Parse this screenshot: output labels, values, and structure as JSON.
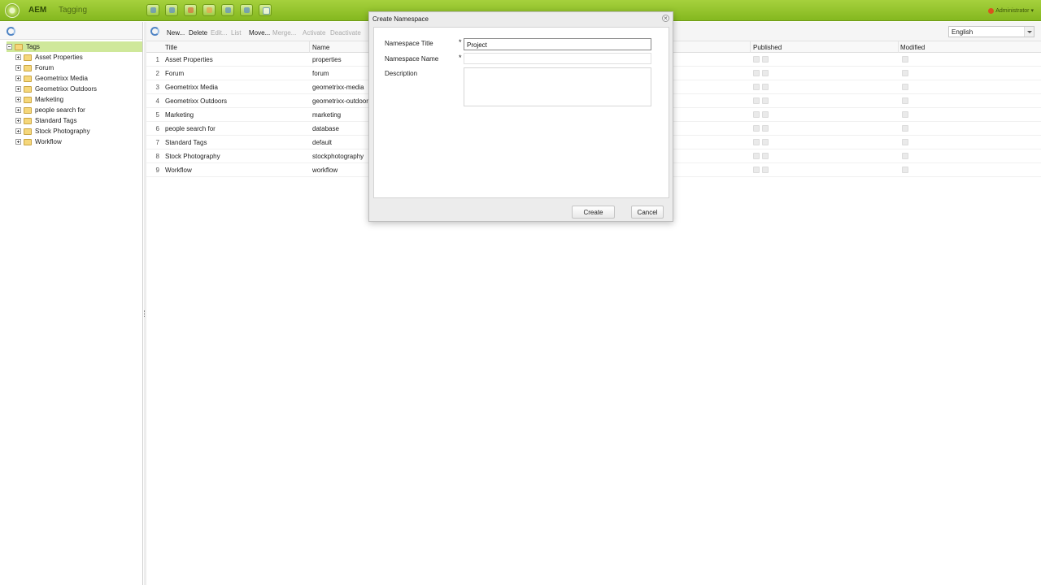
{
  "app": {
    "name": "AEM",
    "page": "Tagging",
    "user": "Administrator"
  },
  "toolbar_icons": [
    "websites-icon",
    "digital-assets-icon",
    "community-icon",
    "campaigns-icon",
    "inbox-icon",
    "workflow-icon",
    "tagging-icon"
  ],
  "tree": {
    "root": "Tags",
    "items": [
      "Asset Properties",
      "Forum",
      "Geometrixx Media",
      "Geometrixx Outdoors",
      "Marketing",
      "people search for",
      "Standard Tags",
      "Stock Photography",
      "Workflow"
    ]
  },
  "actions": {
    "new": "New...",
    "delete": "Delete",
    "edit": "Edit...",
    "list": "List",
    "move": "Move...",
    "merge": "Merge...",
    "activate": "Activate",
    "deactivate": "Deactivate"
  },
  "language": "English",
  "columns": {
    "title": "Title",
    "name": "Name",
    "published": "Published",
    "modified": "Modified"
  },
  "rows": [
    {
      "num": "1",
      "title": "Asset Properties",
      "name": "properties"
    },
    {
      "num": "2",
      "title": "Forum",
      "name": "forum"
    },
    {
      "num": "3",
      "title": "Geometrixx Media",
      "name": "geometrixx-media"
    },
    {
      "num": "4",
      "title": "Geometrixx Outdoors",
      "name": "geometrixx-outdoor"
    },
    {
      "num": "5",
      "title": "Marketing",
      "name": "marketing"
    },
    {
      "num": "6",
      "title": "people search for",
      "name": "database"
    },
    {
      "num": "7",
      "title": "Standard Tags",
      "name": "default"
    },
    {
      "num": "8",
      "title": "Stock Photography",
      "name": "stockphotography"
    },
    {
      "num": "9",
      "title": "Workflow",
      "name": "workflow"
    }
  ],
  "dialog": {
    "title": "Create Namespace",
    "close": "×",
    "required_mark": "*",
    "fields": {
      "ns_title": {
        "label": "Namespace Title",
        "value": "Project"
      },
      "ns_name": {
        "label": "Namespace Name",
        "value": ""
      },
      "description": {
        "label": "Description",
        "value": ""
      }
    },
    "create_label": "Create",
    "cancel_label": "Cancel"
  }
}
